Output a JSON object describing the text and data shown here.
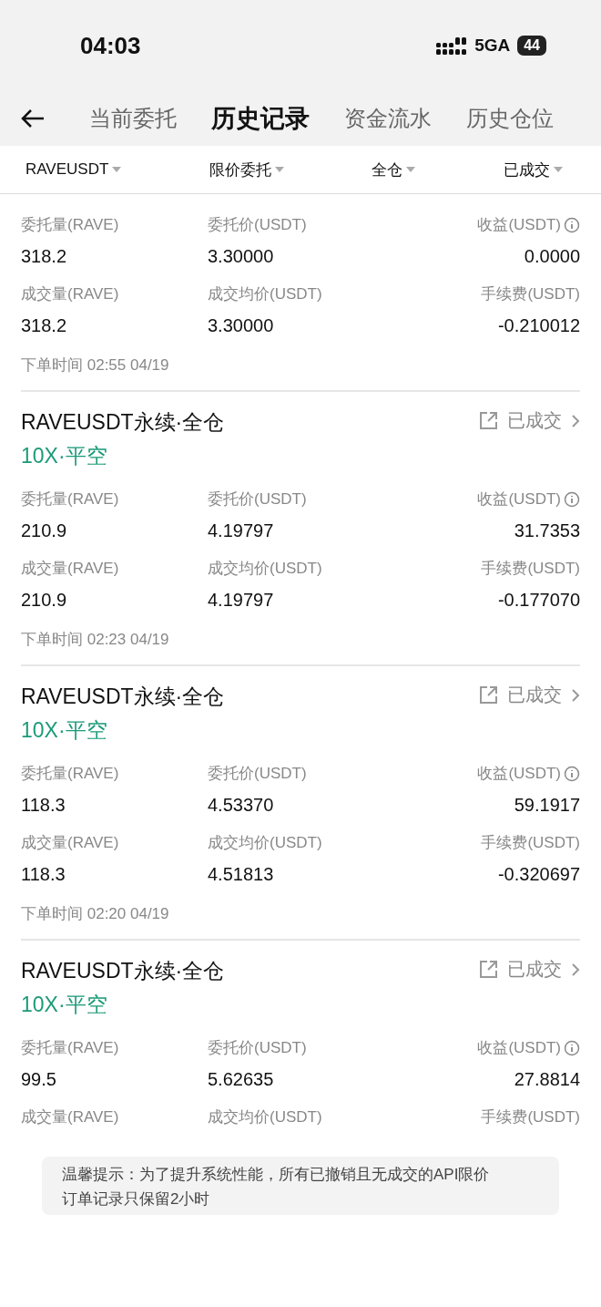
{
  "status_bar": {
    "time": "04:03",
    "network": "5GA",
    "battery": "44"
  },
  "tabs": [
    {
      "label": "当前委托",
      "selected": false
    },
    {
      "label": "历史记录",
      "selected": true
    },
    {
      "label": "资金流水",
      "selected": false
    },
    {
      "label": "历史仓位",
      "selected": false
    }
  ],
  "filters": [
    {
      "label": "RAVEUSDT"
    },
    {
      "label": "限价委托"
    },
    {
      "label": "全仓"
    },
    {
      "label": "已成交"
    }
  ],
  "orders": [
    {
      "fields": [
        {
          "label": "委托量(RAVE)",
          "value": "318.2"
        },
        {
          "label": "委托价(USDT)",
          "value": "3.30000"
        },
        {
          "label": "收益(USDT)",
          "value": "0.0000",
          "info": true
        },
        {
          "label": "成交量(RAVE)",
          "value": "318.2"
        },
        {
          "label": "成交均价(USDT)",
          "value": "3.30000"
        },
        {
          "label": "手续费(USDT)",
          "value": "-0.210012"
        }
      ],
      "time": "下单时间 02:55 04/19"
    },
    {
      "title": "RAVEUSDT永续·全仓",
      "subtitle": "10X·平空",
      "status": "已成交",
      "fields": [
        {
          "label": "委托量(RAVE)",
          "value": "210.9"
        },
        {
          "label": "委托价(USDT)",
          "value": "4.19797"
        },
        {
          "label": "收益(USDT)",
          "value": "31.7353",
          "info": true
        },
        {
          "label": "成交量(RAVE)",
          "value": "210.9"
        },
        {
          "label": "成交均价(USDT)",
          "value": "4.19797"
        },
        {
          "label": "手续费(USDT)",
          "value": "-0.177070"
        }
      ],
      "time": "下单时间 02:23 04/19"
    },
    {
      "title": "RAVEUSDT永续·全仓",
      "subtitle": "10X·平空",
      "status": "已成交",
      "fields": [
        {
          "label": "委托量(RAVE)",
          "value": "118.3"
        },
        {
          "label": "委托价(USDT)",
          "value": "4.53370"
        },
        {
          "label": "收益(USDT)",
          "value": "59.1917",
          "info": true
        },
        {
          "label": "成交量(RAVE)",
          "value": "118.3"
        },
        {
          "label": "成交均价(USDT)",
          "value": "4.51813"
        },
        {
          "label": "手续费(USDT)",
          "value": "-0.320697"
        }
      ],
      "time": "下单时间 02:20 04/19"
    },
    {
      "title": "RAVEUSDT永续·全仓",
      "subtitle": "10X·平空",
      "status": "已成交",
      "fields": [
        {
          "label": "委托量(RAVE)",
          "value": "99.5"
        },
        {
          "label": "委托价(USDT)",
          "value": "5.62635"
        },
        {
          "label": "收益(USDT)",
          "value": "27.8814",
          "info": true
        },
        {
          "label": "成交量(RAVE)"
        },
        {
          "label": "成交均价(USDT)"
        },
        {
          "label": "手续费(USDT)"
        }
      ]
    }
  ],
  "notice": [
    "温馨提示：为了提升系统性能，所有已撤销且无成交的API限价",
    "订单记录只保留2小时"
  ]
}
